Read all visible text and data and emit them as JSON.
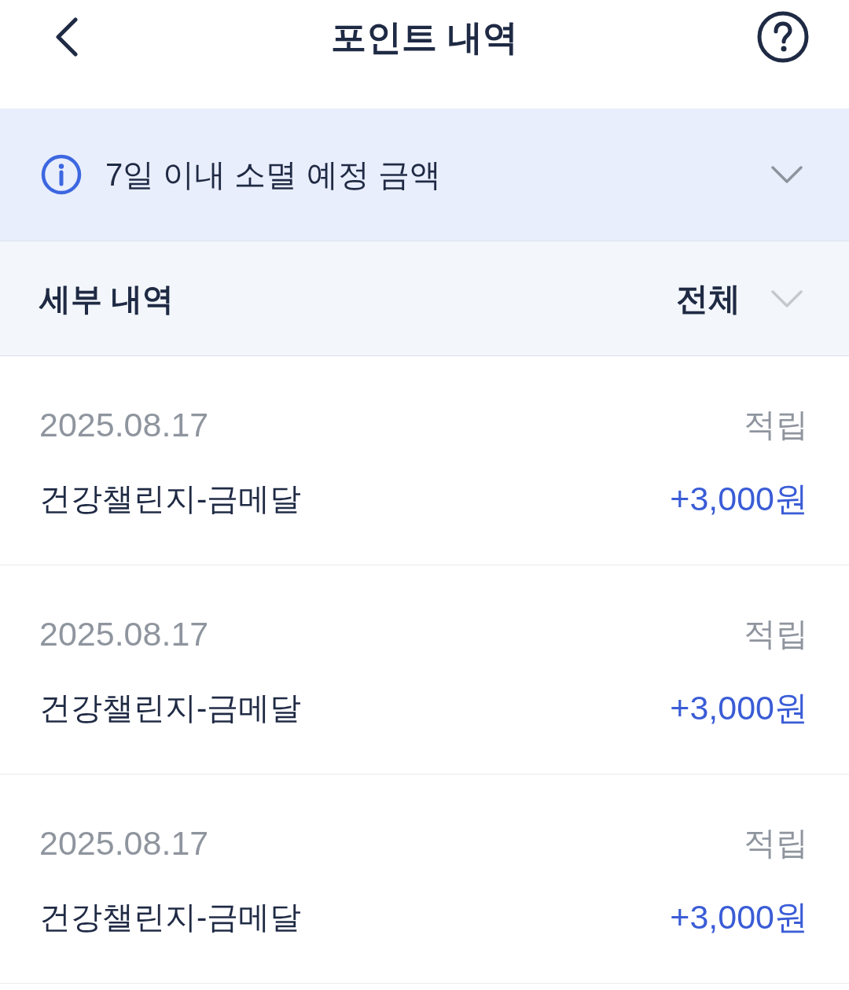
{
  "header": {
    "title": "포인트 내역"
  },
  "notice": {
    "text": "7일 이내 소멸 예정 금액",
    "expanded": false
  },
  "filter": {
    "label": "세부 내역",
    "selection": "전체"
  },
  "transactions": [
    {
      "date": "2025.08.17",
      "type": "적립",
      "name": "건강챌린지-금메달",
      "amount": "+3,000원"
    },
    {
      "date": "2025.08.17",
      "type": "적립",
      "name": "건강챌린지-금메달",
      "amount": "+3,000원"
    },
    {
      "date": "2025.08.17",
      "type": "적립",
      "name": "건강챌린지-금메달",
      "amount": "+3,000원"
    }
  ]
}
